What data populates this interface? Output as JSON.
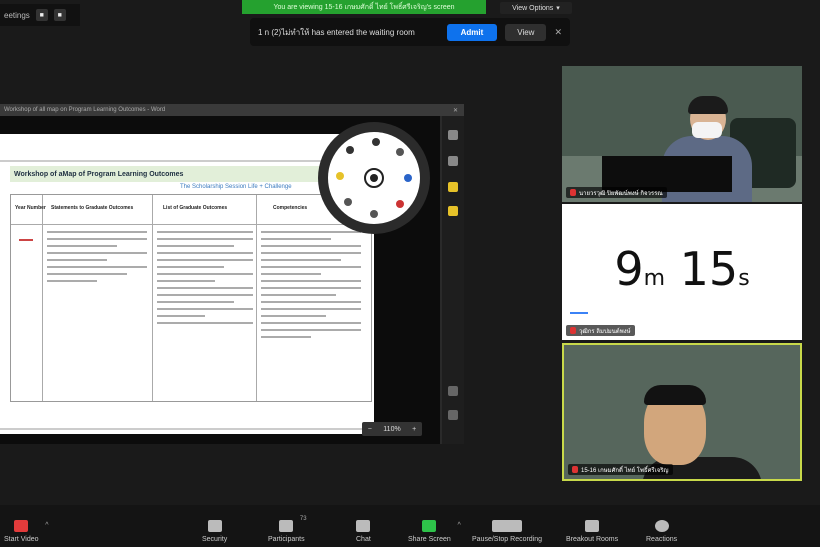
{
  "top_left": {
    "label": "eetings"
  },
  "share_banner": {
    "text": "You are viewing 15-16 เกษมศักดิ์ ไทย์ โพธิ์ศรีเจริญ's screen"
  },
  "view_options": {
    "label": "View Options"
  },
  "waiting_room": {
    "message": "1 n (2)ไม่ทำให้ has entered the waiting room",
    "admit_label": "Admit",
    "view_label": "View"
  },
  "shared_screen": {
    "window_title": "Workshop of all map on Program Learning Outcomes - Word",
    "doc_heading": "Workshop of aMap of Program Learning Outcomes",
    "doc_subheading": "The Scholarship Session Life + Challenge",
    "table_headers": [
      "Year Number",
      "Statements to Graduate Outcomes",
      "List of Graduate Outcomes",
      "Competencies"
    ],
    "zoom_level": "110%"
  },
  "tiles": [
    {
      "name": "นายวรวุฒิ ปิยพัฒน์พงษ์ กิจวรรณ",
      "muted": true
    },
    {
      "name": "วุฒิกร ลิมปมนต์พงษ์",
      "muted": true
    },
    {
      "name": "15-16 เกษมศักดิ์ ไทย์ โพธิ์ศรีเจริญ",
      "muted": true
    }
  ],
  "timer": {
    "minutes": "9",
    "minutes_unit": "m",
    "seconds": "15",
    "seconds_unit": "s"
  },
  "toolbar": {
    "stop_video": "Start Video",
    "security": "Security",
    "participants": "Participants",
    "participants_count": "73",
    "chat": "Chat",
    "share_screen": "Share Screen",
    "pause_recording": "Pause/Stop Recording",
    "breakout_rooms": "Breakout Rooms",
    "reactions": "Reactions"
  },
  "colors": {
    "banner_green": "#25a12f",
    "admit_blue": "#0e72ed",
    "active_speaker_border": "#c8d94a"
  }
}
